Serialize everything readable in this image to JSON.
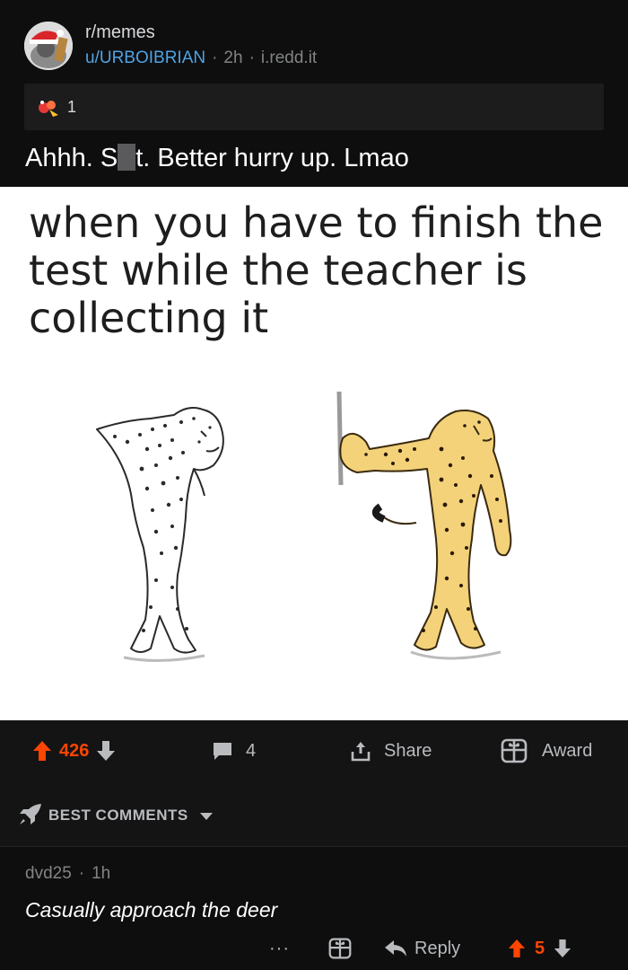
{
  "post": {
    "subreddit": "r/memes",
    "author": "u/URBOIBRIAN",
    "age": "2h",
    "domain": "i.redd.it",
    "award_count": "1",
    "title_part1": "Ahhh. S",
    "title_part2": "t. Better hurry up. Lmao"
  },
  "meme": {
    "caption": "when you have to finish the test while the teacher is collecting it"
  },
  "actions": {
    "upvotes": "426",
    "comments": "4",
    "share_label": "Share",
    "award_label": "Award"
  },
  "comments_section": {
    "sort_label": "BEST COMMENTS"
  },
  "comment": {
    "author": "dvd25",
    "age": "1h",
    "body": "Casually approach the deer",
    "more": "···",
    "reply_label": "Reply",
    "score": "5"
  },
  "colors": {
    "upvote": "#ff4500",
    "username": "#4fa3e3",
    "background": "#0e0e0f",
    "cheetah_fill": "#f3d27a"
  }
}
